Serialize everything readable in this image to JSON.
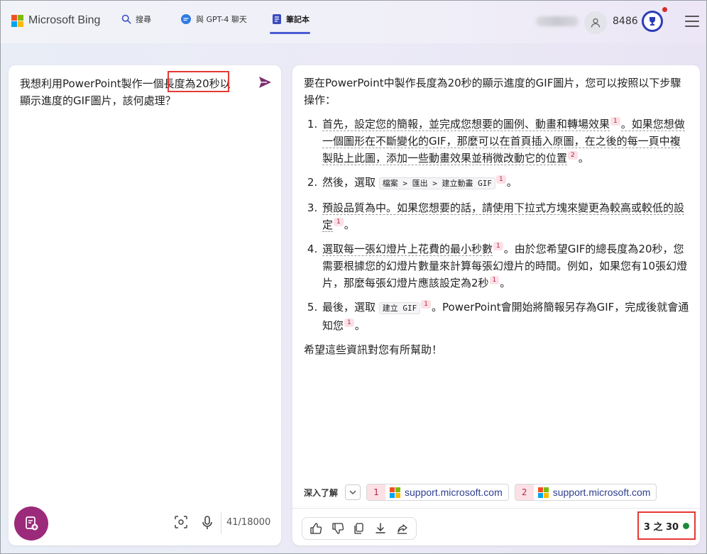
{
  "header": {
    "brand": "Microsoft Bing",
    "nav": [
      {
        "label": "搜尋"
      },
      {
        "label": "與 GPT-4 聊天"
      },
      {
        "label": "筆記本"
      }
    ],
    "points": "8486",
    "accent_color": "#4a5bd4"
  },
  "left": {
    "prompt": "我想利用PowerPoint製作一個長度為20秒以\n顯示進度的GIF圖片，該何處理？",
    "char_count": "41/18000"
  },
  "answer": {
    "intro": "要在PowerPoint中製作長度為20秒的顯示進度的GIF圖片，您可以按照以下步驟操作：",
    "steps": [
      {
        "a": "首先，設定您的簡報，並完成您想要的圖例、動畫和轉場效果",
        "c1": "1",
        "b": "。如果您想做一個圖形在不斷變化的GIF，那麼可以在首頁插入原圖，在之後的每一頁中複製貼上此圖，添加一些動畫效果並稍微改動它的位置",
        "c2": "2",
        "end": "。"
      },
      {
        "a": "然後，選取",
        "code": "檔案 > 匯出 > 建立動畫 GIF",
        "c1": "1",
        "end": "。"
      },
      {
        "a": "預設品質為中。如果您想要的話，請使用下拉式方塊來變更為較高或較低的設定",
        "c1": "1",
        "end": "。"
      },
      {
        "a": "選取每一張幻燈片上花費的最小秒數",
        "c1": "1",
        "b": "。由於您希望GIF的總長度為20秒，您需要根據您的幻燈片數量來計算每張幻燈片的時間。例如，如果您有10張幻燈片，那麼每張幻燈片應該設定為2秒",
        "c2": "1",
        "end": "。"
      },
      {
        "a": "最後，選取",
        "code": "建立 GIF",
        "c1": "1",
        "b": "。PowerPoint會開始將簡報另存為GIF，完成後就會通知您",
        "c2": "1",
        "end": "。"
      }
    ],
    "closing": "希望這些資訊對您有所幫助！"
  },
  "learn_more": {
    "label": "深入了解",
    "sources": [
      {
        "num": "1",
        "domain": "support.microsoft.com"
      },
      {
        "num": "2",
        "domain": "support.microsoft.com"
      }
    ]
  },
  "footer": {
    "turn_count": "3 之 30",
    "status_color": "#1b8a3b"
  },
  "icons": [
    "search-icon",
    "chat-icon",
    "notebook-icon",
    "user-icon",
    "trophy-icon",
    "menu-icon",
    "send-icon",
    "new-note-icon",
    "scan-icon",
    "mic-icon",
    "thumbs-up-icon",
    "thumbs-down-icon",
    "copy-icon",
    "download-icon",
    "share-icon",
    "chevron-down-icon"
  ]
}
